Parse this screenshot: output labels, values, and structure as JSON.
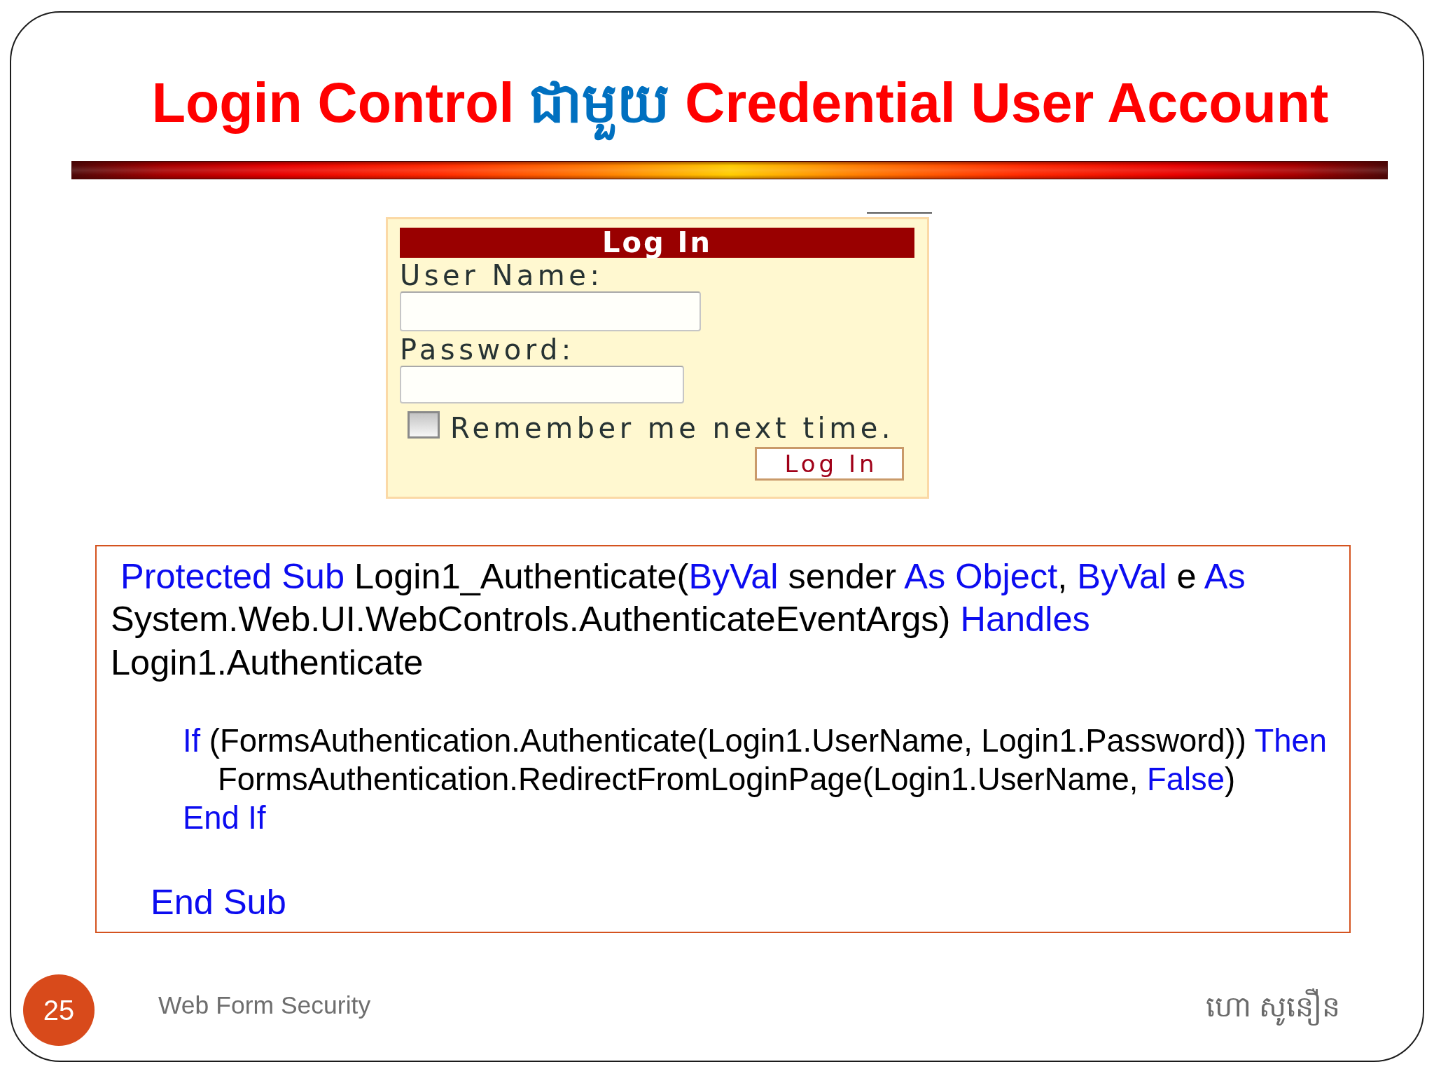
{
  "title": {
    "segments": [
      {
        "text": "Login Control ",
        "kind": "primary"
      },
      {
        "text": "ជាមួយ",
        "kind": "accent"
      },
      {
        "text": " Credential User Account",
        "kind": "primary"
      }
    ]
  },
  "login": {
    "header": "Log In",
    "fields": [
      {
        "label": "User Name:"
      },
      {
        "label": "Password:"
      }
    ],
    "remember": {
      "label": "Remember me next time.",
      "checked": false
    },
    "button": "Log In"
  },
  "code": {
    "signature": [
      {
        "segments": [
          {
            "text": "Protected Sub",
            "kind": "keyword"
          },
          {
            "text": " Login1_Authenticate(",
            "kind": "plain"
          },
          {
            "text": "ByVal",
            "kind": "keyword"
          },
          {
            "text": " sender ",
            "kind": "plain"
          },
          {
            "text": "As Object",
            "kind": "keyword"
          },
          {
            "text": ", ",
            "kind": "plain"
          },
          {
            "text": "ByVal",
            "kind": "keyword"
          },
          {
            "text": " e ",
            "kind": "plain"
          },
          {
            "text": "As",
            "kind": "keyword"
          }
        ]
      },
      {
        "segments": [
          {
            "text": "System.Web.UI.WebControls.AuthenticateEventArgs) ",
            "kind": "plain"
          },
          {
            "text": "Handles",
            "kind": "keyword"
          }
        ]
      },
      {
        "segments": [
          {
            "text": "Login1.Authenticate",
            "kind": "plain"
          }
        ]
      }
    ],
    "body": [
      {
        "segments": [
          {
            "text": "If",
            "kind": "keyword"
          },
          {
            "text": " (FormsAuthentication.Authenticate(Login1.UserName, Login1.Password)) ",
            "kind": "plain"
          },
          {
            "text": "Then",
            "kind": "keyword"
          }
        ],
        "children": [
          {
            "segments": [
              {
                "text": "FormsAuthentication.RedirectFromLoginPage(Login1.UserName, ",
                "kind": "plain"
              },
              {
                "text": "False",
                "kind": "keyword"
              },
              {
                "text": ")",
                "kind": "plain"
              }
            ]
          }
        ]
      },
      {
        "segments": [
          {
            "text": "End If",
            "kind": "keyword"
          }
        ]
      }
    ],
    "closing": {
      "segments": [
        {
          "text": "End Sub",
          "kind": "keyword"
        }
      ]
    }
  },
  "footer": {
    "page_number": "25",
    "title": "Web Form Security",
    "author": "ហោ សូនឿន"
  }
}
